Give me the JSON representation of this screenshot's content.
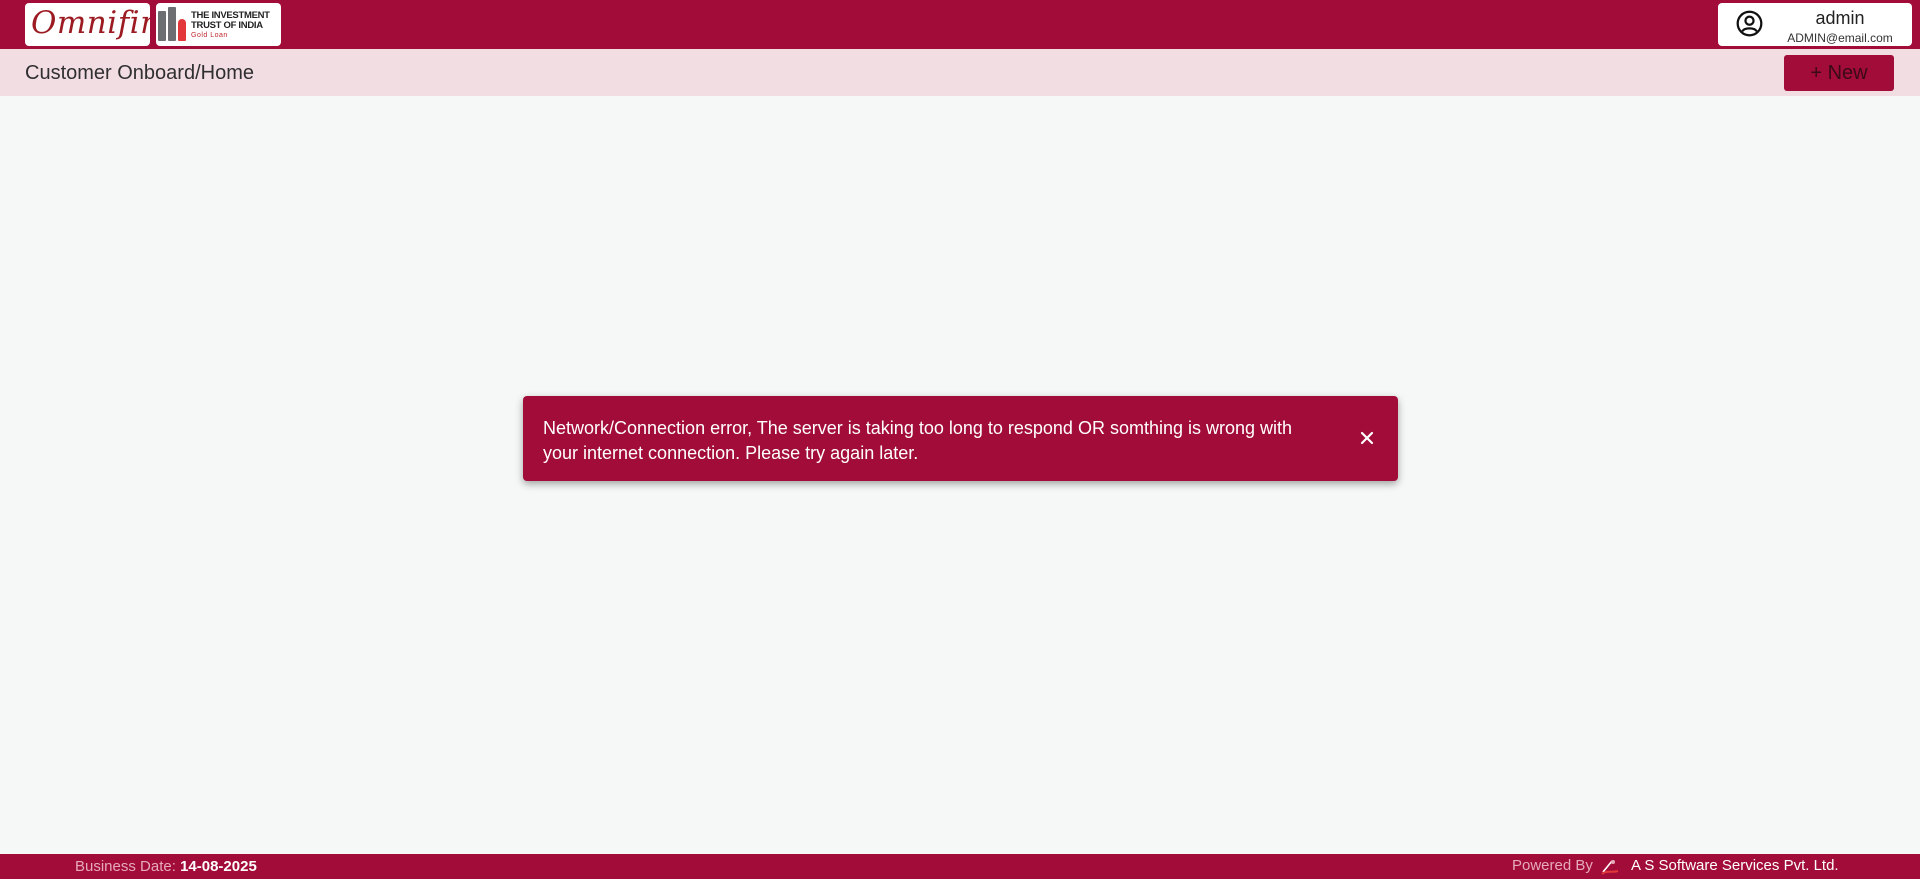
{
  "header": {
    "logo_omnifin": "Omnifin",
    "logo_iti": [
      "THE INVESTMENT",
      "TRUST OF INDIA"
    ],
    "logo_iti_sub": "Gold Loan",
    "user": {
      "name": "admin",
      "email": "ADMIN@email.com",
      "icon": "user-circle-icon"
    }
  },
  "subheader": {
    "breadcrumb": "Customer Onboard/Home",
    "new_button_label": "+ New"
  },
  "toast": {
    "message": "Network/Connection error, The server is taking too long to respond OR somthing is wrong with your internet connection. Please try again later.",
    "close_icon": "close-icon"
  },
  "footer": {
    "business_date_label": "Business Date:",
    "business_date_value": "14-08-2025",
    "powered_by": "Powered By",
    "company": "A S Software Services Pvt. Ltd."
  },
  "colors": {
    "brand": "#a20c39",
    "subheader_bg": "#f2dde3",
    "page_bg": "#f6f8f7"
  }
}
